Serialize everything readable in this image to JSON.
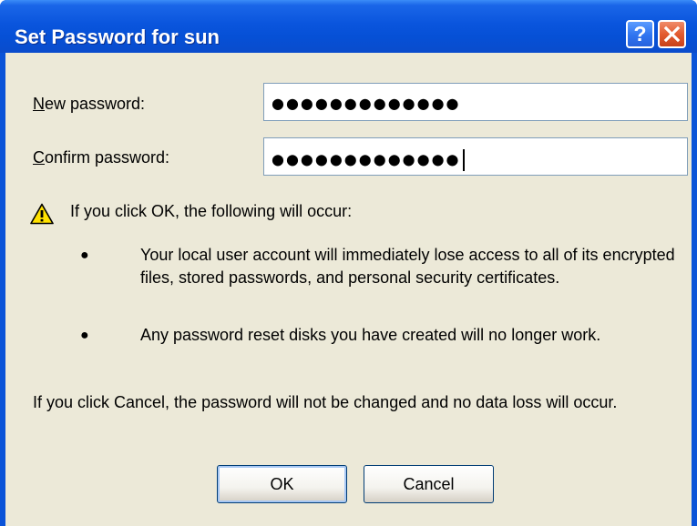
{
  "window": {
    "title": "Set Password for sun",
    "help_glyph": "?",
    "close_icon": "close-icon"
  },
  "form": {
    "new_password": {
      "label_mnemonic": "N",
      "label_rest": "ew password:",
      "value_masked": "●●●●●●●●●●●●●"
    },
    "confirm_password": {
      "label_mnemonic": "C",
      "label_rest": "onfirm password:",
      "value_masked": "●●●●●●●●●●●●●"
    }
  },
  "warning": {
    "icon": "warning-icon",
    "heading": "If you click OK, the following will occur:",
    "bullets": [
      "Your local user account will immediately lose access to all of its encrypted files, stored passwords, and personal security certificates.",
      "Any password reset disks you have created will no longer work."
    ],
    "cancel_note": "If you click Cancel, the password will not be changed and no data loss will occur."
  },
  "buttons": {
    "ok_label": "OK",
    "cancel_label": "Cancel"
  },
  "colors": {
    "titlebar": "#0a55dd",
    "dialog_bg": "#ece9d8",
    "close_button": "#e35b30",
    "help_button": "#2f74f0"
  }
}
